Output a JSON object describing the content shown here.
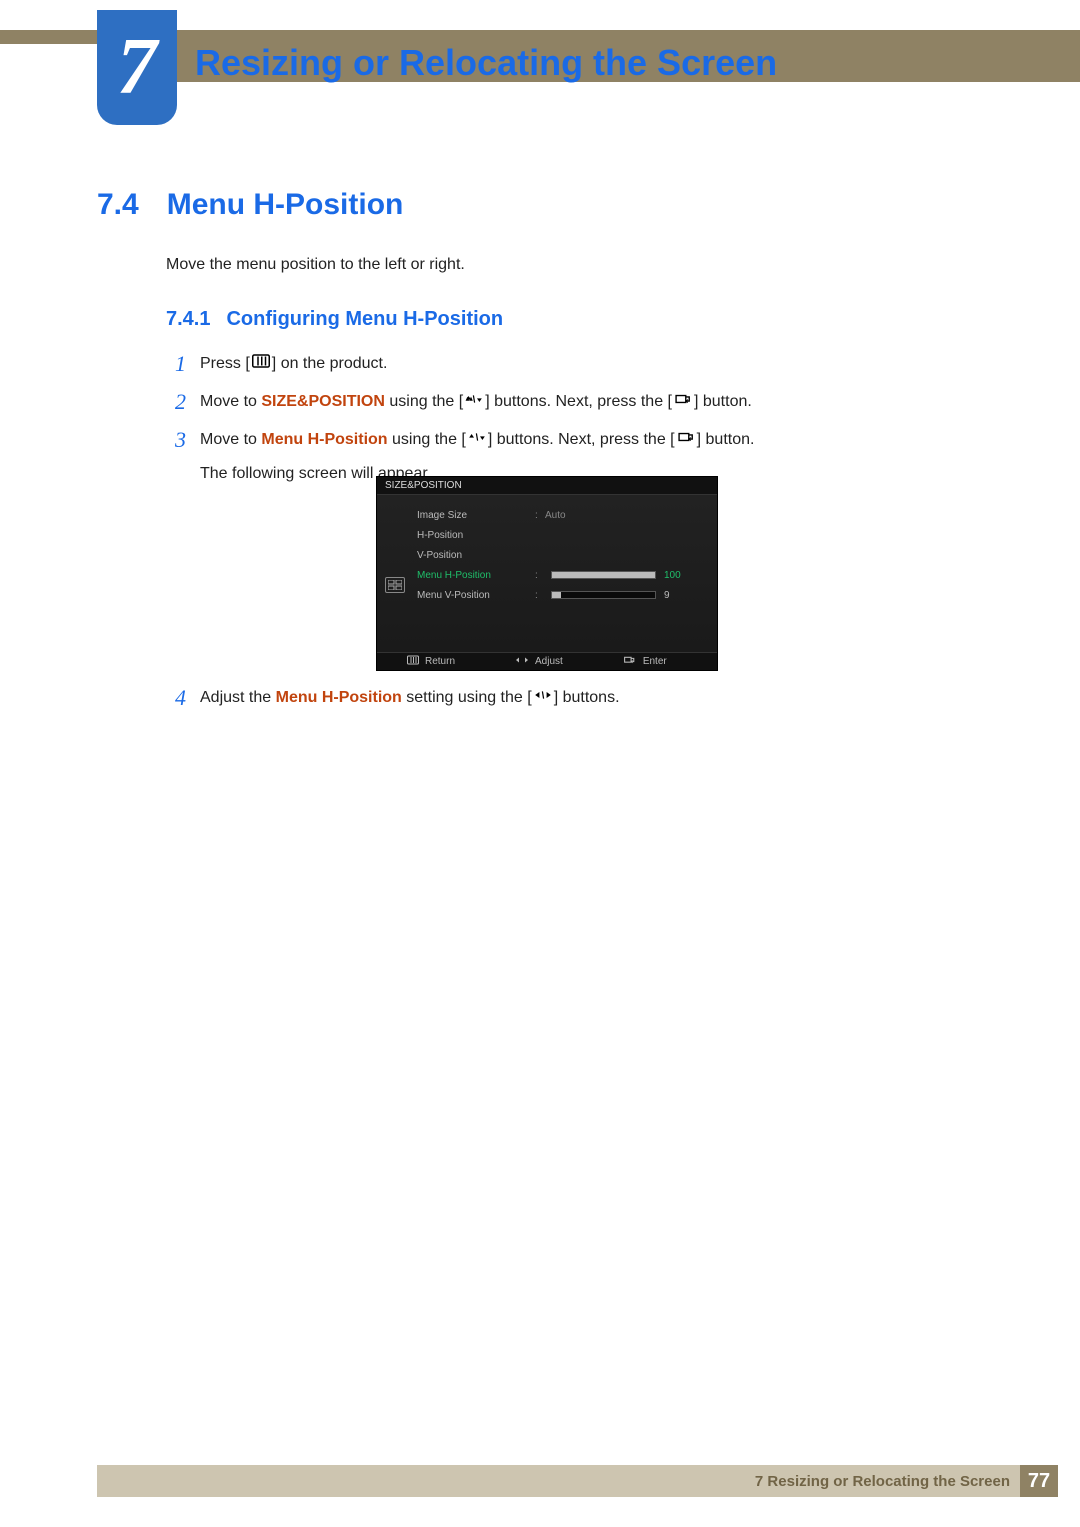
{
  "chapter": {
    "number": "7",
    "title": "Resizing or Relocating the Screen"
  },
  "section": {
    "number": "7.4",
    "title": "Menu H-Position"
  },
  "intro": "Move the menu position to the left or right.",
  "subsection": {
    "number": "7.4.1",
    "title": "Configuring Menu H-Position"
  },
  "steps": {
    "s1": {
      "num": "1",
      "t1": "Press [",
      "t2": "] on the product."
    },
    "s2": {
      "num": "2",
      "t1": "Move to ",
      "red": "SIZE&POSITION",
      "t2": " using the [",
      "t3": "] buttons. Next, press the [",
      "t4": "] button."
    },
    "s3": {
      "num": "3",
      "t1": "Move to ",
      "red": "Menu H-Position",
      "t2": " using the [",
      "t3": "] buttons. Next, press the [",
      "t4": "] button.",
      "extra": "The following screen will appear."
    },
    "s4": {
      "num": "4",
      "t1": "Adjust the ",
      "red": "Menu H-Position",
      "t2": " setting using the [",
      "t3": "] buttons."
    }
  },
  "osd": {
    "title": "SIZE&POSITION",
    "rows": {
      "image_size": {
        "label": "Image Size",
        "value": "Auto"
      },
      "h_position": {
        "label": "H-Position"
      },
      "v_position": {
        "label": "V-Position"
      },
      "menu_h": {
        "label": "Menu H-Position",
        "value": "100",
        "fill_pct": 100
      },
      "menu_v": {
        "label": "Menu V-Position",
        "value": "9",
        "fill_pct": 9
      }
    },
    "footer": {
      "return": "Return",
      "adjust": "Adjust",
      "enter": "Enter"
    }
  },
  "footer": {
    "text": "7 Resizing or Relocating the Screen",
    "page": "77"
  }
}
